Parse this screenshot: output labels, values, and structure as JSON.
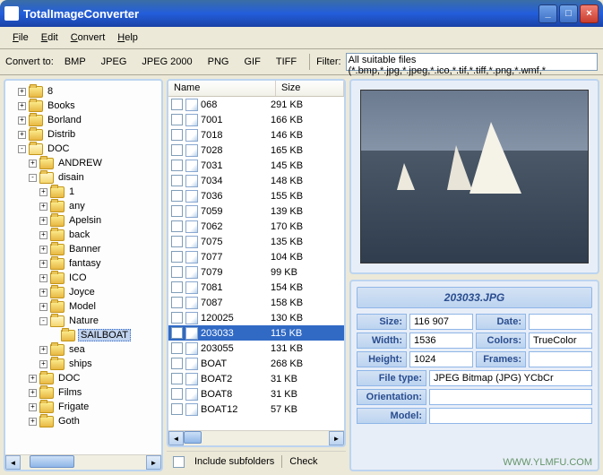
{
  "window": {
    "title": "TotalImageConverter"
  },
  "menu": {
    "file": "File",
    "edit": "Edit",
    "convert": "Convert",
    "help": "Help"
  },
  "toolbar": {
    "convert_to": "Convert to:",
    "formats": [
      "BMP",
      "JPEG",
      "JPEG 2000",
      "PNG",
      "GIF",
      "TIFF"
    ],
    "filter_label": "Filter:",
    "filter_value": "All suitable files (*.bmp,*.jpg,*.jpeg,*.ico,*.tif,*.tiff,*.png,*.wmf,*"
  },
  "tree": [
    {
      "depth": 1,
      "exp": "+",
      "label": "8"
    },
    {
      "depth": 1,
      "exp": "+",
      "label": "Books"
    },
    {
      "depth": 1,
      "exp": "+",
      "label": "Borland"
    },
    {
      "depth": 1,
      "exp": "+",
      "label": "Distrib"
    },
    {
      "depth": 1,
      "exp": "-",
      "label": "DOC",
      "open": true
    },
    {
      "depth": 2,
      "exp": "+",
      "label": "ANDREW"
    },
    {
      "depth": 2,
      "exp": "-",
      "label": "disain",
      "open": true
    },
    {
      "depth": 3,
      "exp": "+",
      "label": "1"
    },
    {
      "depth": 3,
      "exp": "+",
      "label": "any"
    },
    {
      "depth": 3,
      "exp": "+",
      "label": "Apelsin"
    },
    {
      "depth": 3,
      "exp": "+",
      "label": "back"
    },
    {
      "depth": 3,
      "exp": "+",
      "label": "Banner"
    },
    {
      "depth": 3,
      "exp": "+",
      "label": "fantasy"
    },
    {
      "depth": 3,
      "exp": "+",
      "label": "ICO"
    },
    {
      "depth": 3,
      "exp": "+",
      "label": "Joyce"
    },
    {
      "depth": 3,
      "exp": "+",
      "label": "Model"
    },
    {
      "depth": 3,
      "exp": "-",
      "label": "Nature",
      "open": true
    },
    {
      "depth": 4,
      "exp": "",
      "label": "SAILBOAT",
      "selected": true
    },
    {
      "depth": 3,
      "exp": "+",
      "label": "sea"
    },
    {
      "depth": 3,
      "exp": "+",
      "label": "ships"
    },
    {
      "depth": 2,
      "exp": "+",
      "label": "DOC"
    },
    {
      "depth": 2,
      "exp": "+",
      "label": "Films"
    },
    {
      "depth": 2,
      "exp": "+",
      "label": "Frigate"
    },
    {
      "depth": 2,
      "exp": "+",
      "label": "Goth"
    }
  ],
  "list": {
    "name_header": "Name",
    "size_header": "Size",
    "rows": [
      {
        "name": "068",
        "size": "291 KB"
      },
      {
        "name": "7001",
        "size": "166 KB"
      },
      {
        "name": "7018",
        "size": "146 KB"
      },
      {
        "name": "7028",
        "size": "165 KB"
      },
      {
        "name": "7031",
        "size": "145 KB"
      },
      {
        "name": "7034",
        "size": "148 KB"
      },
      {
        "name": "7036",
        "size": "155 KB"
      },
      {
        "name": "7059",
        "size": "139 KB"
      },
      {
        "name": "7062",
        "size": "170 KB"
      },
      {
        "name": "7075",
        "size": "135 KB"
      },
      {
        "name": "7077",
        "size": "104 KB"
      },
      {
        "name": "7079",
        "size": "99 KB"
      },
      {
        "name": "7081",
        "size": "154 KB"
      },
      {
        "name": "7087",
        "size": "158 KB"
      },
      {
        "name": "120025",
        "size": "130 KB"
      },
      {
        "name": "203033",
        "size": "115 KB",
        "selected": true
      },
      {
        "name": "203055",
        "size": "131 KB"
      },
      {
        "name": "BOAT",
        "size": "268 KB"
      },
      {
        "name": "BOAT2",
        "size": "31 KB"
      },
      {
        "name": "BOAT8",
        "size": "31 KB"
      },
      {
        "name": "BOAT12",
        "size": "57 KB"
      }
    ],
    "include_subfolders": "Include subfolders",
    "check": "Check"
  },
  "info": {
    "filename": "203033.JPG",
    "labels": {
      "size": "Size:",
      "date": "Date:",
      "width": "Width:",
      "colors": "Colors:",
      "height": "Height:",
      "frames": "Frames:",
      "filetype": "File type:",
      "orientation": "Orientation:",
      "model": "Model:"
    },
    "values": {
      "size": "116 907",
      "date": "",
      "width": "1536",
      "colors": "TrueColor",
      "height": "1024",
      "frames": "",
      "filetype": "JPEG Bitmap (JPG) YCbCr",
      "orientation": "",
      "model": ""
    }
  },
  "watermark": "WWW.YLMFU.COM"
}
